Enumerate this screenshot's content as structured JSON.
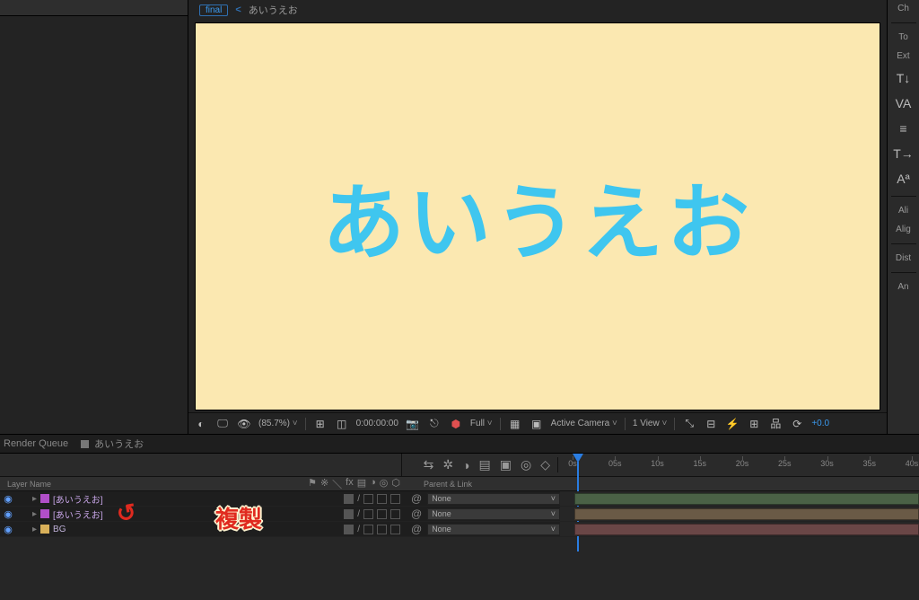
{
  "breadcrumb": {
    "root": "final",
    "current": "あいうえお"
  },
  "canvas": {
    "text": "あいうえお",
    "bg": "#fbe8b1",
    "textColor": "#3fc6ef"
  },
  "viewerToolbar": {
    "zoom": "(85.7%)",
    "timecode": "0:00:00:00",
    "resolution": "Full",
    "camera": "Active Camera",
    "views": "1 View",
    "exposure": "+0.0"
  },
  "rightPanel": {
    "items": [
      "Ch",
      "To",
      "Ext",
      "Ali",
      "Alig",
      "Dist",
      "An"
    ]
  },
  "tabs": {
    "renderQueue": "Render Queue",
    "comp": "あいうえお"
  },
  "timeline": {
    "header": {
      "layerName": "Layer Name",
      "parentLink": "Parent & Link"
    },
    "ticks": [
      "0s",
      "05s",
      "10s",
      "15s",
      "20s",
      "25s",
      "30s",
      "35s",
      "40s"
    ],
    "layers": [
      {
        "name": "[あいうえお]",
        "type": "text",
        "parent": "None"
      },
      {
        "name": "[あいうえお]",
        "type": "text",
        "parent": "None"
      },
      {
        "name": "BG",
        "type": "solid",
        "parent": "None"
      }
    ]
  },
  "annotation": {
    "label": "複製"
  }
}
